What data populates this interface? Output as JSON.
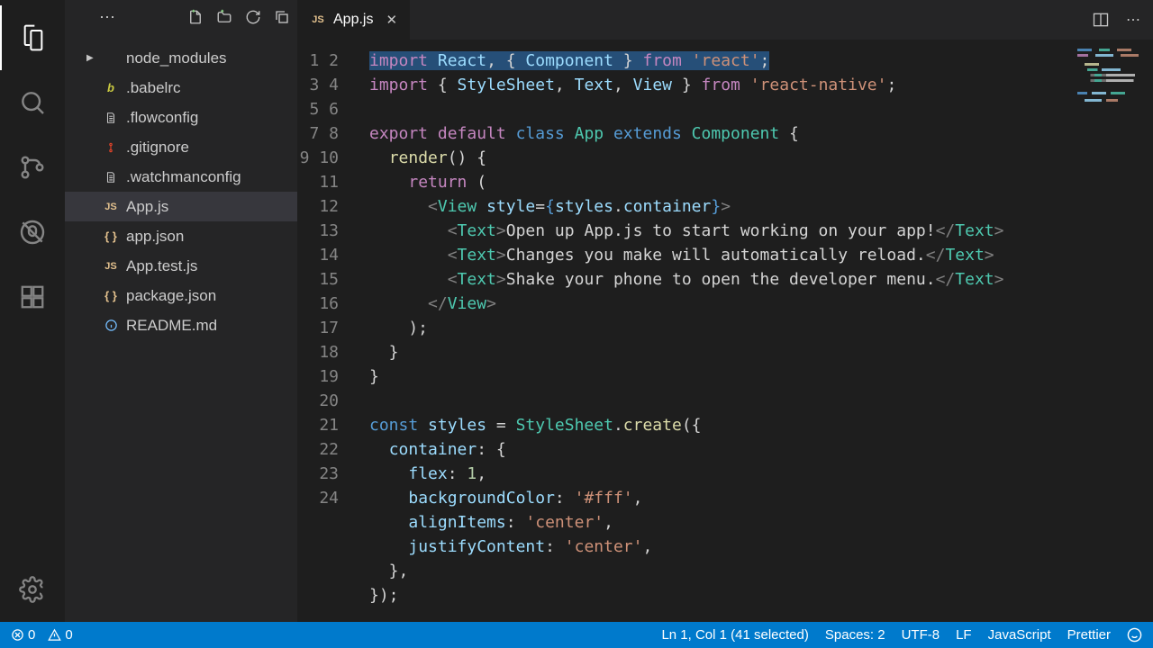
{
  "activity": {
    "items": [
      "files",
      "search",
      "source-control",
      "debug",
      "extensions"
    ],
    "bottom": [
      "settings"
    ]
  },
  "sidebar": {
    "files": [
      {
        "name": "node_modules",
        "icon": "folder",
        "chevron": true
      },
      {
        "name": ".babelrc",
        "icon": "babel"
      },
      {
        "name": ".flowconfig",
        "icon": "file"
      },
      {
        "name": ".gitignore",
        "icon": "git"
      },
      {
        "name": ".watchmanconfig",
        "icon": "file"
      },
      {
        "name": "App.js",
        "icon": "js",
        "selected": true
      },
      {
        "name": "app.json",
        "icon": "json"
      },
      {
        "name": "App.test.js",
        "icon": "js"
      },
      {
        "name": "package.json",
        "icon": "json"
      },
      {
        "name": "README.md",
        "icon": "info"
      }
    ]
  },
  "tabs": {
    "active": {
      "icon": "js",
      "label": "App.js"
    }
  },
  "editor": {
    "line_count": 24,
    "lines_html": [
      "<span class='sel'><span class='tk-kw'>import</span> <span class='tk-var'>React</span>, { <span class='tk-var'>Component</span> } <span class='tk-kw'>from</span> <span class='tk-str'>'react'</span>;</span>",
      "<span class='tk-kw'>import</span> { <span class='tk-var'>StyleSheet</span>, <span class='tk-var'>Text</span>, <span class='tk-var'>View</span> } <span class='tk-kw'>from</span> <span class='tk-str'>'react-native'</span>;",
      "",
      "<span class='tk-kw'>export</span> <span class='tk-kw'>default</span> <span class='tk-const'>class</span> <span class='tk-type'>App</span> <span class='tk-const'>extends</span> <span class='tk-type'>Component</span> {",
      "  <span class='tk-fn'>render</span>() {",
      "    <span class='tk-kw'>return</span> (",
      "      <span class='tk-tag'>&lt;</span><span class='tk-tagname'>View</span> <span class='tk-attr'>style</span>=<span class='tk-const'>{</span><span class='tk-var'>styles</span>.<span class='tk-var'>container</span><span class='tk-const'>}</span><span class='tk-tag'>&gt;</span>",
      "        <span class='tk-tag'>&lt;</span><span class='tk-tagname'>Text</span><span class='tk-tag'>&gt;</span>Open up App.js to start working on your app!<span class='tk-tag'>&lt;/</span><span class='tk-tagname'>Text</span><span class='tk-tag'>&gt;</span>",
      "        <span class='tk-tag'>&lt;</span><span class='tk-tagname'>Text</span><span class='tk-tag'>&gt;</span>Changes you make will automatically reload.<span class='tk-tag'>&lt;/</span><span class='tk-tagname'>Text</span><span class='tk-tag'>&gt;</span>",
      "        <span class='tk-tag'>&lt;</span><span class='tk-tagname'>Text</span><span class='tk-tag'>&gt;</span>Shake your phone to open the developer menu.<span class='tk-tag'>&lt;/</span><span class='tk-tagname'>Text</span><span class='tk-tag'>&gt;</span>",
      "      <span class='tk-tag'>&lt;/</span><span class='tk-tagname'>View</span><span class='tk-tag'>&gt;</span>",
      "    );",
      "  }",
      "}",
      "",
      "<span class='tk-const'>const</span> <span class='tk-var'>styles</span> = <span class='tk-type'>StyleSheet</span>.<span class='tk-fn'>create</span>({",
      "  <span class='tk-var'>container</span>: {",
      "    <span class='tk-var'>flex</span>: <span class='tk-num'>1</span>,",
      "    <span class='tk-var'>backgroundColor</span>: <span class='tk-str'>'#fff'</span>,",
      "    <span class='tk-var'>alignItems</span>: <span class='tk-str'>'center'</span>,",
      "    <span class='tk-var'>justifyContent</span>: <span class='tk-str'>'center'</span>,",
      "  },",
      "});",
      ""
    ]
  },
  "status": {
    "errors": "0",
    "warnings": "0",
    "position": "Ln 1, Col 1 (41 selected)",
    "spaces": "Spaces: 2",
    "encoding": "UTF-8",
    "eol": "LF",
    "language": "JavaScript",
    "formatter": "Prettier"
  }
}
